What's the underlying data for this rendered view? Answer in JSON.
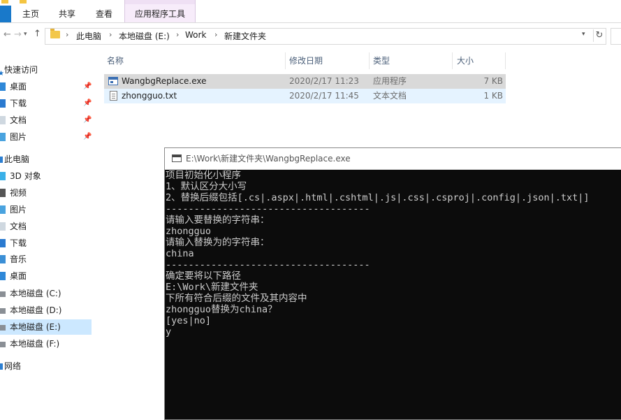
{
  "ribbon": {
    "tabs": [
      {
        "label": "主页"
      },
      {
        "label": "共享"
      },
      {
        "label": "查看"
      }
    ],
    "context_tab": {
      "label": "应用程序工具"
    }
  },
  "address": {
    "segments": [
      "此电脑",
      "本地磁盘 (E:)",
      "Work",
      "新建文件夹"
    ]
  },
  "nav": {
    "quick_access": "快速访问",
    "quick_items": [
      {
        "label": "桌面",
        "icon": "desktop-icon"
      },
      {
        "label": "下载",
        "icon": "download-icon"
      },
      {
        "label": "文档",
        "icon": "documents-icon"
      },
      {
        "label": "图片",
        "icon": "pictures-icon"
      }
    ],
    "this_pc": "此电脑",
    "pc_items": [
      {
        "label": "3D 对象",
        "icon": "3d-objects-icon"
      },
      {
        "label": "视频",
        "icon": "videos-icon"
      },
      {
        "label": "图片",
        "icon": "pictures-icon"
      },
      {
        "label": "文档",
        "icon": "documents-icon"
      },
      {
        "label": "下载",
        "icon": "download-icon"
      },
      {
        "label": "音乐",
        "icon": "music-icon"
      },
      {
        "label": "桌面",
        "icon": "desktop-icon"
      },
      {
        "label": "本地磁盘 (C:)",
        "icon": "drive-icon"
      },
      {
        "label": "本地磁盘 (D:)",
        "icon": "drive-icon"
      },
      {
        "label": "本地磁盘 (E:)",
        "icon": "drive-icon"
      },
      {
        "label": "本地磁盘 (F:)",
        "icon": "drive-icon"
      }
    ],
    "network": "网络",
    "selected": "本地磁盘 (E:)"
  },
  "files": {
    "columns": {
      "name": "名称",
      "date": "修改日期",
      "type": "类型",
      "size": "大小"
    },
    "rows": [
      {
        "name": "WangbgReplace.exe",
        "date": "2020/2/17 11:23",
        "type": "应用程序",
        "size": "7 KB",
        "icon": "exe-icon",
        "state": "selected"
      },
      {
        "name": "zhongguo.txt",
        "date": "2020/2/17 11:45",
        "type": "文本文档",
        "size": "1 KB",
        "icon": "text-file-icon",
        "state": "hover"
      }
    ]
  },
  "console": {
    "title": "E:\\Work\\新建文件夹\\WangbgReplace.exe",
    "lines": [
      "项目初始化小程序",
      "1、默认区分大小写",
      "2、替换后缀包括[.cs|.aspx|.html|.cshtml|.js|.css|.csproj|.config|.json|.txt|]",
      "------------------------------------",
      "请输入要替换的字符串：",
      "zhongguo",
      "请输入替换为的字符串：",
      "china",
      "------------------------------------",
      "确定要将以下路径",
      "E:\\Work\\新建文件夹",
      "下所有符合后缀的文件及其内容中",
      "zhongguo替换为china？",
      "[yes|no]",
      "y"
    ]
  },
  "colors": {
    "selection": "#cce8ff",
    "row_selected": "#d9d9d9",
    "row_hover": "#e5f3ff",
    "console_bg": "#0c0c0c",
    "console_fg": "#cccccc",
    "file_tab": "#1979ca",
    "context_tab": "#f7ecfa"
  }
}
